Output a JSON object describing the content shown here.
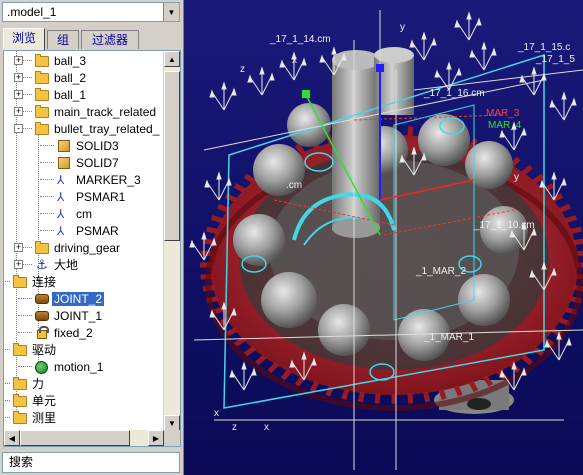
{
  "model_select": {
    "value": ".model_1"
  },
  "tabs": [
    {
      "label": "浏览",
      "active": true
    },
    {
      "label": "组",
      "active": false
    },
    {
      "label": "过滤器",
      "active": false
    }
  ],
  "tree": {
    "items": [
      {
        "label": "ball_3",
        "icon": "folder-icon"
      },
      {
        "label": "ball_2",
        "icon": "folder-icon"
      },
      {
        "label": "ball_1",
        "icon": "folder-icon"
      },
      {
        "label": "main_track_related",
        "icon": "folder-icon"
      },
      {
        "label": "bullet_tray_related_",
        "icon": "folder-icon"
      },
      {
        "label": "SOLID3",
        "icon": "solid-icon"
      },
      {
        "label": "SOLID7",
        "icon": "solid-icon"
      },
      {
        "label": "MARKER_3",
        "icon": "marker-icon"
      },
      {
        "label": "PSMAR1",
        "icon": "marker-icon"
      },
      {
        "label": "cm",
        "icon": "marker-icon"
      },
      {
        "label": "PSMAR",
        "icon": "marker-icon"
      },
      {
        "label": "driving_gear",
        "icon": "folder-icon"
      },
      {
        "label": "大地",
        "icon": "ground-icon"
      },
      {
        "label": "连接",
        "icon": "folder-icon"
      },
      {
        "label": "JOINT_2",
        "icon": "joint-icon",
        "selected": true
      },
      {
        "label": "JOINT_1",
        "icon": "joint-icon"
      },
      {
        "label": "fixed_2",
        "icon": "lock-icon"
      },
      {
        "label": "驱动",
        "icon": "folder-icon"
      },
      {
        "label": "motion_1",
        "icon": "motion-icon"
      },
      {
        "label": "力",
        "icon": "folder-icon"
      },
      {
        "label": "单元",
        "icon": "folder-icon"
      },
      {
        "label": "测里",
        "icon": "folder-icon"
      }
    ]
  },
  "search": {
    "value": "搜索"
  },
  "viewport": {
    "labels": {
      "marker_a": "_17_1_14.cm",
      "marker_b": "_17_1_15.c",
      "marker_c": "_17_1_5",
      "marker_d": "_17_1_10.cm",
      "marker_e": ".cm",
      "marker_f": "MAR_3",
      "marker_g": "MAR_4",
      "marker_h": "_17_1_16.cm",
      "marker_i": "_1_MAR_2",
      "marker_j": "_1_MAR_1",
      "axis_x": "x",
      "axis_y": "y",
      "axis_z": "z"
    },
    "colors": {
      "background": "#12126e",
      "gear_red": "#b3202a",
      "balls_gray": "#a8a8a8",
      "wireframe_cyan": "#40d8e8",
      "triad_white": "#e8e8e8",
      "highlight_green": "#30e030",
      "axis_blue": "#2020ff"
    }
  }
}
